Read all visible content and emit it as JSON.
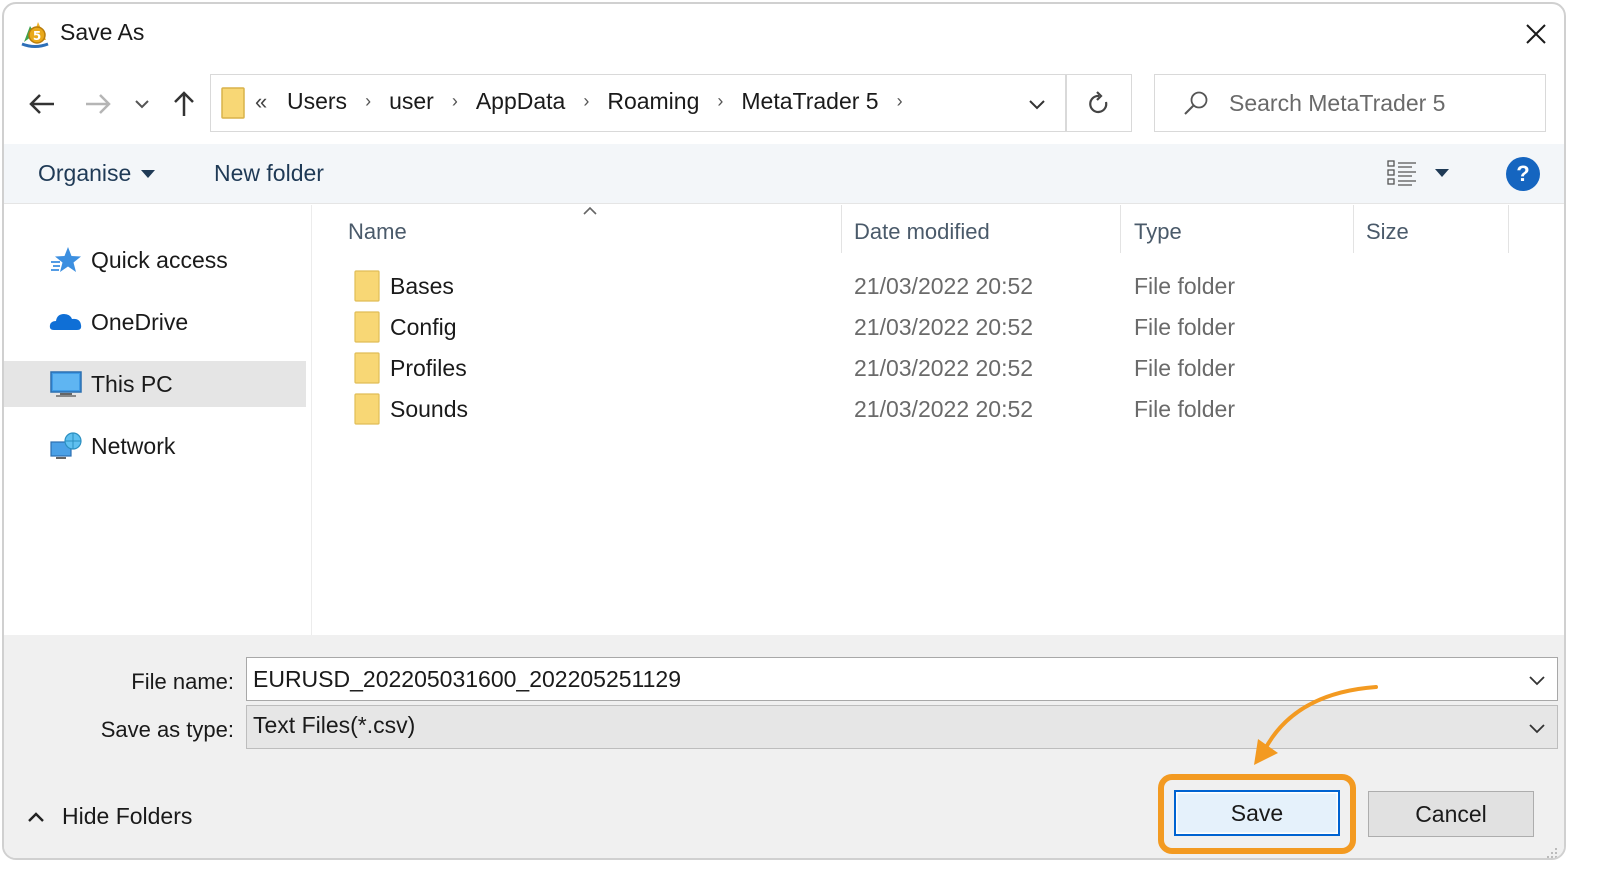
{
  "window": {
    "title": "Save As"
  },
  "address": {
    "overflow": "«",
    "crumbs": [
      "Users",
      "user",
      "AppData",
      "Roaming",
      "MetaTrader 5"
    ],
    "separator": "›"
  },
  "search": {
    "placeholder": "Search MetaTrader 5"
  },
  "toolbar": {
    "organise": "Organise",
    "new_folder": "New folder",
    "help": "?"
  },
  "nav": {
    "items": [
      {
        "label": "Quick access",
        "icon": "star-icon"
      },
      {
        "label": "OneDrive",
        "icon": "cloud-icon"
      },
      {
        "label": "This PC",
        "icon": "monitor-icon",
        "selected": true
      },
      {
        "label": "Network",
        "icon": "network-icon"
      }
    ]
  },
  "columns": {
    "name": "Name",
    "date": "Date modified",
    "type": "Type",
    "size": "Size"
  },
  "files": [
    {
      "name": "Bases",
      "date": "21/03/2022 20:52",
      "type": "File folder"
    },
    {
      "name": "Config",
      "date": "21/03/2022 20:52",
      "type": "File folder"
    },
    {
      "name": "Profiles",
      "date": "21/03/2022 20:52",
      "type": "File folder"
    },
    {
      "name": "Sounds",
      "date": "21/03/2022 20:52",
      "type": "File folder"
    }
  ],
  "form": {
    "file_name_label": "File name:",
    "file_name_value": "EURUSD_202205031600_202205251129",
    "save_type_label": "Save as type:",
    "save_type_value": "Text Files(*.csv)"
  },
  "footer": {
    "hide_folders": "Hide Folders",
    "save": "Save",
    "cancel": "Cancel"
  },
  "colors": {
    "accent_orange": "#f39a21",
    "save_border": "#0063d1",
    "help_blue": "#1565c0",
    "folder_yellow": "#f8d775"
  }
}
